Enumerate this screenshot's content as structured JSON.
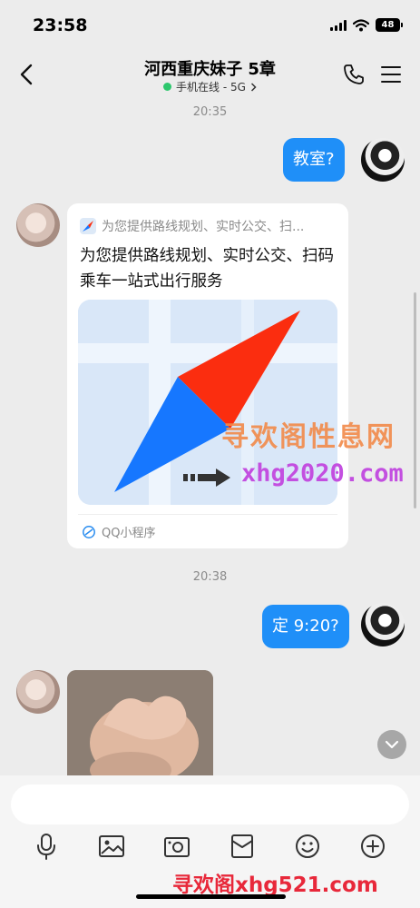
{
  "status_bar": {
    "time": "23:58",
    "battery": "48"
  },
  "nav": {
    "title": "河西重庆妹子 5章",
    "subtitle": "手机在线 - 5G",
    "online_color": "#2dc76d"
  },
  "messages": [
    {
      "type": "timestamp",
      "text": "20:35"
    },
    {
      "type": "text",
      "from": "self",
      "text": "教室?"
    },
    {
      "type": "mini-program",
      "from": "friend",
      "header": "为您提供路线规划、实时公交、扫...",
      "description": "为您提供路线规划、实时公交、扫码乘车一站式出行服务",
      "footer": "QQ小程序"
    },
    {
      "type": "timestamp",
      "text": "20:38"
    },
    {
      "type": "text",
      "from": "self",
      "text": "定 9:20?"
    },
    {
      "type": "image",
      "from": "friend",
      "image": "hand-sticker"
    }
  ],
  "watermark": {
    "line1": "寻欢阁性息网",
    "line2": "xhg2020.com",
    "bottom": "寻欢阁xhg521.com"
  },
  "toolbar": {
    "items": [
      "mic-icon",
      "photo-icon",
      "camera-icon",
      "red-packet-icon",
      "emoji-icon",
      "plus-icon"
    ]
  },
  "colors": {
    "bubble_out": "#1f8ff8",
    "background": "#ececec",
    "accent_red": "#fb2d0f",
    "accent_blue": "#1677ff"
  }
}
